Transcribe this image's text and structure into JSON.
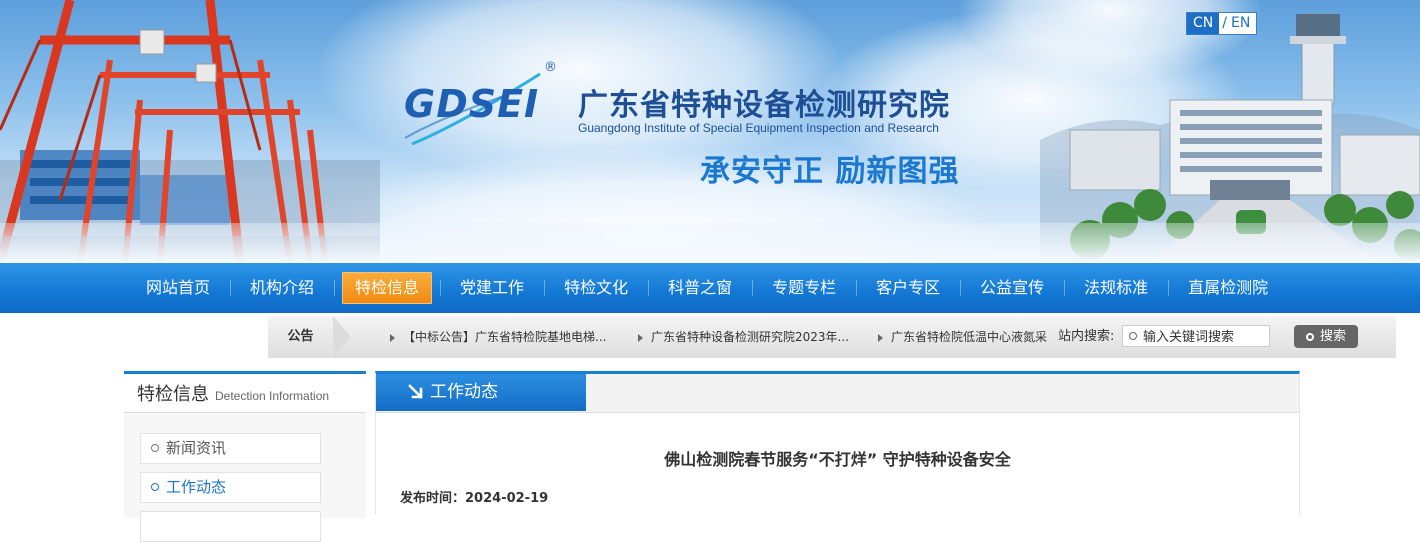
{
  "header": {
    "lang_cn": "CN",
    "lang_sep": "/",
    "lang_en": "EN",
    "logo": "GDSEI",
    "logo_mark": "®",
    "org_name_cn": "广东省特种设备检测研究院",
    "org_name_en": "Guangdong Institute of Special Equipment Inspection and Research",
    "slogan": "承安守正 励新图强"
  },
  "nav": {
    "items": [
      {
        "label": "网站首页"
      },
      {
        "label": "机构介绍"
      },
      {
        "label": "特检信息"
      },
      {
        "label": "党建工作"
      },
      {
        "label": "特检文化"
      },
      {
        "label": "科普之窗"
      },
      {
        "label": "专题专栏"
      },
      {
        "label": "客户专区"
      },
      {
        "label": "公益宣传"
      },
      {
        "label": "法规标准"
      },
      {
        "label": "直属检测院"
      }
    ],
    "active_index": 2
  },
  "notice": {
    "caption": "公告",
    "items": [
      {
        "text": "【中标公告】广东省特检院基地电梯..."
      },
      {
        "text": "广东省特种设备检测研究院2023年..."
      },
      {
        "text": "广东省特检院低温中心液氮采"
      }
    ]
  },
  "search": {
    "label": "站内搜索:",
    "placeholder": "输入关键词搜索",
    "button_label": "搜索"
  },
  "sidebar": {
    "title": "特检信息",
    "subtitle": "Detection Information",
    "items": [
      {
        "label": "新闻资讯"
      },
      {
        "label": "工作动态"
      }
    ],
    "active_index": 1
  },
  "main": {
    "section_title": "工作动态",
    "article_title": "佛山检测院春节服务“不打烊” 守护特种设备安全",
    "publish_label": "发布时间：",
    "publish_date": "2024-02-19"
  },
  "colors": {
    "nav_blue": "#1377d4",
    "active_orange": "#ef8a12",
    "brand_blue": "#1e4f95",
    "slogan_blue": "#1b78cf"
  }
}
